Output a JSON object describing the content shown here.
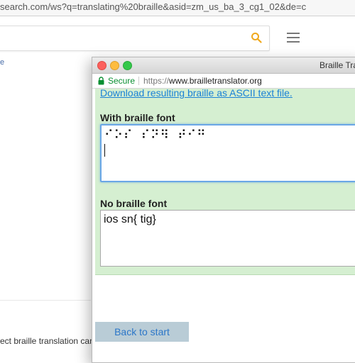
{
  "background_browser": {
    "url_text": "search.com/ws?q=translating%20braille&asid=zm_us_ba_3_cg1_02&de=c",
    "left_fragment": "e",
    "snippet": "ect braille translation can c"
  },
  "window": {
    "title": "Braille Tra",
    "secure_label": "Secure",
    "url_scheme": "https://",
    "url_host": "www.brailletranslator.org",
    "download_link": "Download resulting braille as ASCII text file.",
    "braille_label": "With braille font",
    "braille_value": "⠊⠕⠎ ⠎⠝⠻ ⠞⠊⠛",
    "plain_label": "No braille font",
    "plain_value": "ios sn{ tig}",
    "back_button": "Back to start"
  },
  "colors": {
    "panel_bg": "#d5efd1",
    "link": "#1b82d6",
    "secure": "#0a8f32",
    "button_bg": "#b9ccd6"
  },
  "icons": [
    "search-icon",
    "menu-icon",
    "lock-icon"
  ]
}
